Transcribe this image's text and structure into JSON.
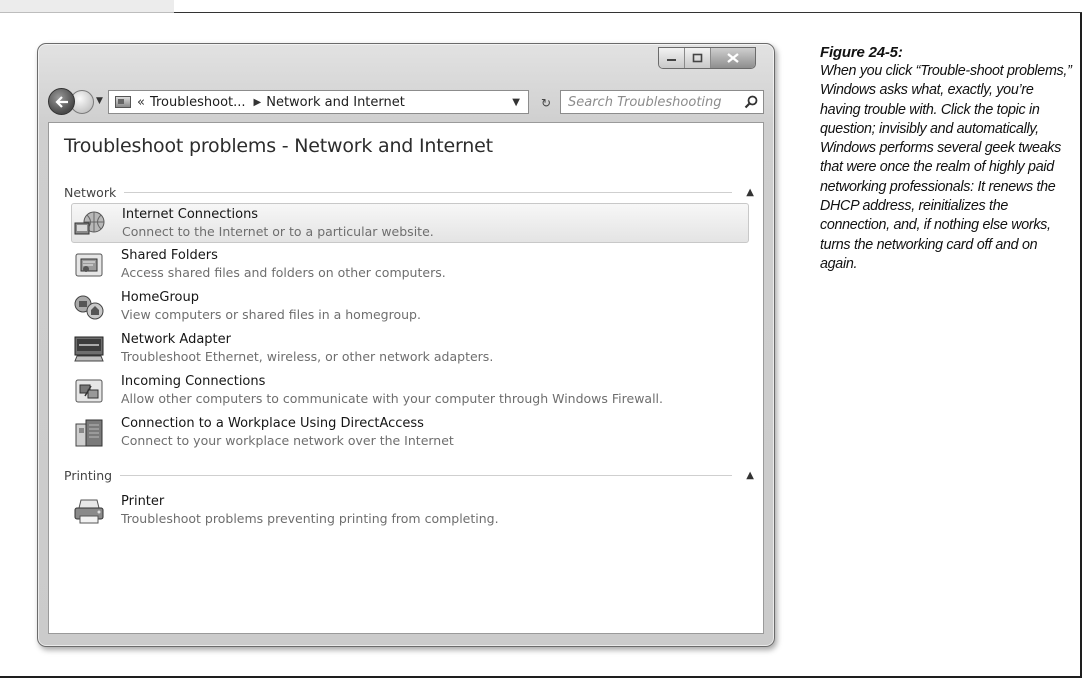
{
  "caption": {
    "figure_label": "Figure 24-5:",
    "text": "When you click “Trouble-shoot problems,” Windows asks what, exactly, you’re having trouble with. Click the topic in question; invisibly and automatically, Windows performs several geek tweaks that were once the realm of highly paid networking professionals: It renews the DHCP address, reinitializes the connection, and, if nothing else works, turns the networking card off and on again."
  },
  "window": {
    "caption_buttons": [
      "minimize",
      "maximize",
      "close"
    ]
  },
  "toolbar": {
    "breadcrumb": {
      "chevrons": "«",
      "segments": [
        "Troubleshoot...",
        "Network and Internet"
      ]
    },
    "search_placeholder": "Search Troubleshooting"
  },
  "main": {
    "title": "Troubleshoot problems - Network and Internet",
    "groups": [
      {
        "header": "Network",
        "items": [
          {
            "title": "Internet Connections",
            "description": "Connect to the Internet or to a particular website.",
            "icon": "internet-connections-icon",
            "selected": true
          },
          {
            "title": "Shared Folders",
            "description": "Access shared files and folders on other computers.",
            "icon": "shared-folders-icon",
            "selected": false
          },
          {
            "title": "HomeGroup",
            "description": "View computers or shared files in a homegroup.",
            "icon": "homegroup-icon",
            "selected": false
          },
          {
            "title": "Network Adapter",
            "description": "Troubleshoot Ethernet, wireless, or other network adapters.",
            "icon": "network-adapter-icon",
            "selected": false
          },
          {
            "title": "Incoming Connections",
            "description": "Allow other computers to communicate with your computer through Windows Firewall.",
            "icon": "incoming-connections-icon",
            "selected": false
          },
          {
            "title": "Connection to a Workplace Using DirectAccess",
            "description": "Connect to your workplace network over the Internet",
            "icon": "directaccess-icon",
            "selected": false
          }
        ]
      },
      {
        "header": "Printing",
        "items": [
          {
            "title": "Printer",
            "description": "Troubleshoot problems preventing printing from completing.",
            "icon": "printer-icon",
            "selected": false
          }
        ]
      }
    ]
  }
}
